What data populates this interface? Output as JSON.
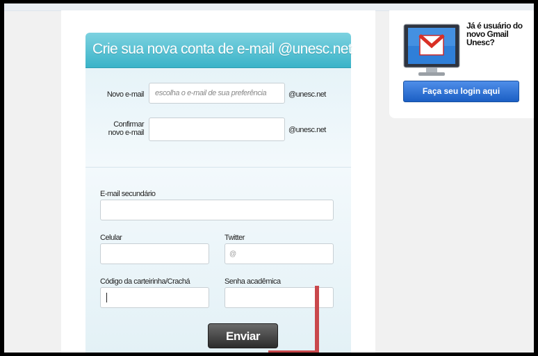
{
  "form": {
    "title": "Crie sua nova conta de e-mail @unesc.net",
    "new_email": {
      "label": "Novo e-mail",
      "placeholder": "escolha o e-mail de sua preferência",
      "suffix": "@unesc.net"
    },
    "confirm_email": {
      "label": "Confirmar novo e-mail",
      "value": "",
      "suffix": "@unesc.net"
    },
    "secondary_email": {
      "label": "E-mail secundário",
      "value": ""
    },
    "phone": {
      "label": "Celular",
      "value": ""
    },
    "twitter": {
      "label": "Twitter",
      "prefix": "@"
    },
    "card_code": {
      "label": "Código da carteirinha/Crachá",
      "value": ""
    },
    "academic_password": {
      "label": "Senha acadêmica",
      "value": ""
    },
    "submit_label": "Enviar"
  },
  "sidebar": {
    "question": "Já é usuário do novo Gmail Unesc?",
    "login_label": "Faça seu login aqui",
    "icon": "gmail-monitor-icon"
  },
  "colors": {
    "header_gradient_top": "#7dd2e0",
    "header_gradient_bottom": "#3ab3c8",
    "login_button": "#2a6fd6",
    "submit_button": "#3a3a3a",
    "annotation_line": "#c9484c"
  }
}
